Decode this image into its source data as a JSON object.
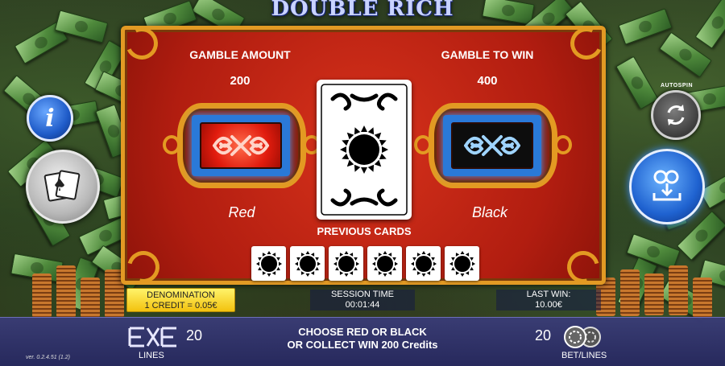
{
  "title": "DOUBLE RICH",
  "gamble": {
    "amount_label": "GAMBLE AMOUNT",
    "amount_value": "200",
    "towin_label": "GAMBLE TO WIN",
    "towin_value": "400",
    "red_caption": "Red",
    "black_caption": "Black",
    "previous_cards_label": "PREVIOUS CARDS",
    "previous_cards": [
      "sun",
      "sun",
      "sun",
      "sun",
      "sun",
      "sun"
    ]
  },
  "buttons": {
    "info_icon": "i",
    "autospin_label": "AUTOSPIN"
  },
  "info": {
    "denomination_label": "DENOMINATION",
    "denomination_value": "1 CREDIT = 0.05€",
    "session_label": "SESSION TIME",
    "session_value": "00:01:44",
    "lastwin_label": "LAST WIN:",
    "lastwin_value": "10.00€"
  },
  "bottom": {
    "lines_value": "20",
    "lines_label": "LINES",
    "message_line1": "CHOOSE RED OR BLACK",
    "message_line2": "OR COLLECT WIN 200 Credits",
    "bet_value": "20",
    "bet_label": "BET/LINES",
    "version": "ver. 0.2.4.51 (1.2)"
  },
  "colors": {
    "panel_red": "#c62514",
    "frame_gold": "#e29a24",
    "bar_blue": "#3a3c7a",
    "denom_yellow": "#f3c20e"
  }
}
